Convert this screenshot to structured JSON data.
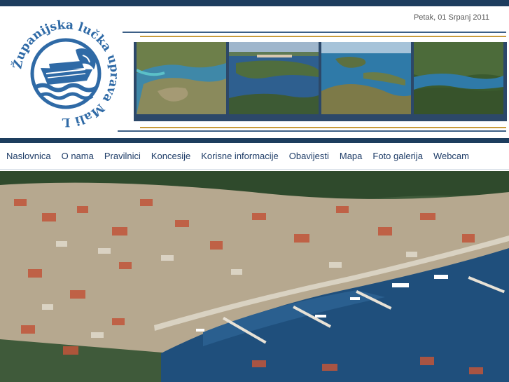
{
  "header": {
    "date": "Petak, 01 Srpanj 2011",
    "logo_text": "Županijska lučka uprava Mali Lošinj",
    "colors": {
      "dark_band": "#1d3d5e",
      "accent_blue": "#3c5f86",
      "accent_gold": "#c89b3a",
      "logo_blue": "#2f6aa6"
    }
  },
  "photos": [
    {
      "name": "aerial-photo-islets"
    },
    {
      "name": "aerial-photo-town-bay"
    },
    {
      "name": "aerial-photo-channel"
    },
    {
      "name": "aerial-photo-forest-coast"
    }
  ],
  "nav": {
    "items": [
      "Naslovnica",
      "O nama",
      "Pravilnici",
      "Koncesije",
      "Korisne informacije",
      "Obavijesti",
      "Mapa",
      "Foto galerija",
      "Webcam"
    ]
  },
  "hero": {
    "name": "harbor-aerial-photo"
  }
}
